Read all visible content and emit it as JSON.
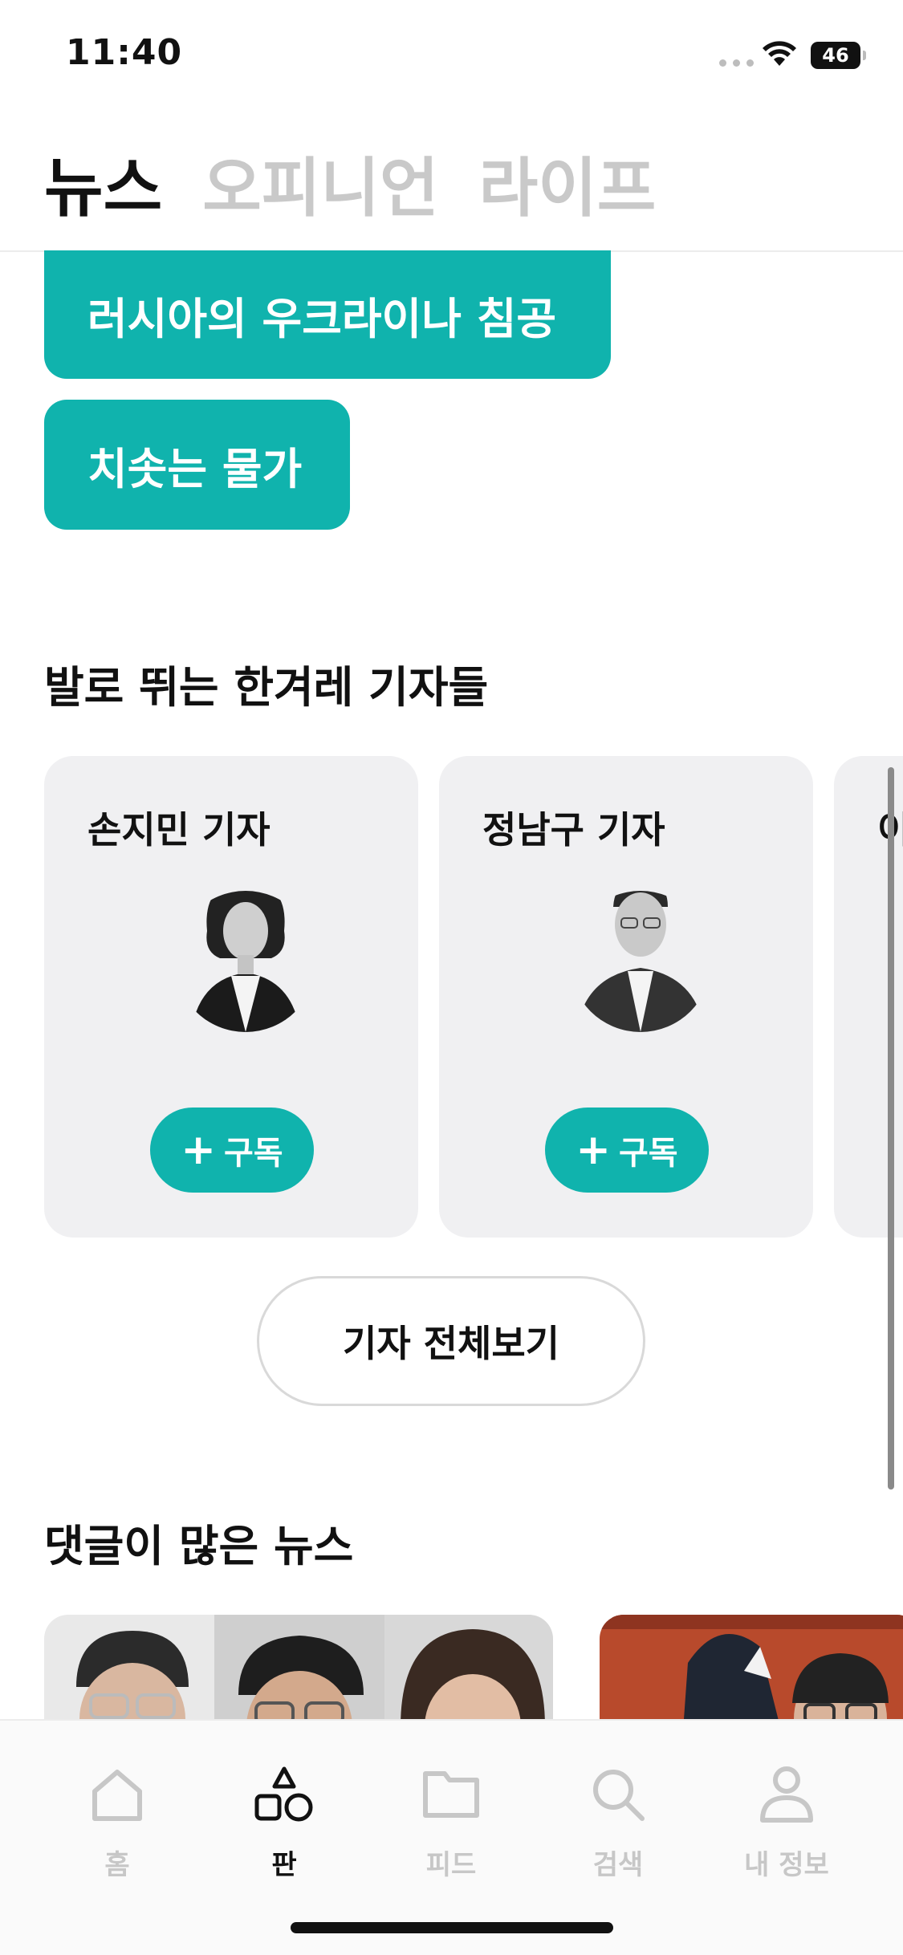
{
  "status_bar": {
    "time": "11:40",
    "battery": "46"
  },
  "top_tabs": [
    {
      "label": "뉴스",
      "active": true
    },
    {
      "label": "오피니언",
      "active": false
    },
    {
      "label": "라이프",
      "active": false
    }
  ],
  "topics": [
    "러시아의 우크라이나 침공",
    "치솟는 물가"
  ],
  "reporters_section": {
    "title": "발로 뛰는 한겨레 기자들",
    "cards": [
      {
        "name": "손지민 기자",
        "subscribe_label": "구독"
      },
      {
        "name": "정남구 기자",
        "subscribe_label": "구독"
      },
      {
        "name": "이"
      }
    ],
    "view_all_label": "기자 전체보기"
  },
  "comment_news_section": {
    "title": "댓글이 많은 뉴스"
  },
  "bottom_nav": [
    {
      "label": "홈",
      "icon": "home-icon",
      "active": false
    },
    {
      "label": "판",
      "icon": "shapes-icon",
      "active": true
    },
    {
      "label": "피드",
      "icon": "folder-icon",
      "active": false
    },
    {
      "label": "검색",
      "icon": "search-icon",
      "active": false
    },
    {
      "label": "내 정보",
      "icon": "person-icon",
      "active": false
    }
  ],
  "colors": {
    "accent": "#10b3ad",
    "inactive": "#c7c7c7",
    "card_bg": "#f0f0f2"
  }
}
